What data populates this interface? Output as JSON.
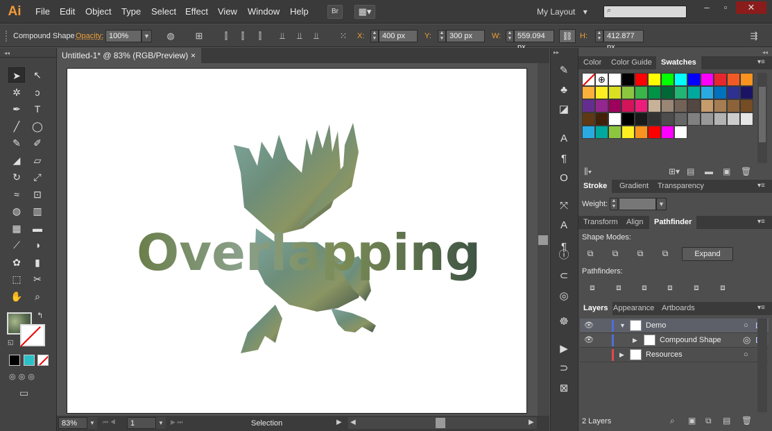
{
  "app": {
    "logo": "Ai"
  },
  "menu": [
    "File",
    "Edit",
    "Object",
    "Type",
    "Select",
    "Effect",
    "View",
    "Window",
    "Help"
  ],
  "topbar": {
    "bridge": "Br",
    "workspace": "My Layout",
    "workspace_arrow": "▾"
  },
  "control": {
    "selection_type": "Compound Shape",
    "opacity_label": "Opacity:",
    "opacity_value": "100%",
    "x_label": "X:",
    "x_value": "400 px",
    "y_label": "Y:",
    "y_value": "300 px",
    "w_label": "W:",
    "w_value": "559.094 px",
    "h_label": "H:",
    "h_value": "412.877 px"
  },
  "document": {
    "tab_title": "Untitled-1* @ 83% (RGB/Preview)",
    "close": "×",
    "artwork_text": "Overlapping"
  },
  "status": {
    "zoom": "83%",
    "artboard": "1",
    "mode": "Selection"
  },
  "swatches_panel": {
    "tabs": [
      "Color",
      "Color Guide",
      "Swatches"
    ],
    "swatch_colors": [
      "#ffffff",
      "#000000",
      "#ff0000",
      "#ffff00",
      "#00ff00",
      "#00ffff",
      "#0000ff",
      "#ff00ff",
      "#e8262e",
      "#f15a24",
      "#f7931e",
      "#fbb03b",
      "#fcee21",
      "#d9e021",
      "#8cc63f",
      "#39b54a",
      "#009245",
      "#006837",
      "#22b573",
      "#00a99d",
      "#29abe2",
      "#0071bc",
      "#2e3192",
      "#1b1464",
      "#662d91",
      "#93278f",
      "#9e005d",
      "#d4145a",
      "#ed1e79",
      "#c7b299",
      "#998675",
      "#736357",
      "#534741",
      "#c69c6d",
      "#a67c52",
      "#8c6239",
      "#754c24",
      "#603813",
      "#42210b",
      "#ffffff",
      "#000000",
      "#1a1a1a",
      "#333333",
      "#4d4d4d",
      "#666666",
      "#808080",
      "#999999",
      "#b3b3b3",
      "#cccccc",
      "#e6e6e6",
      "#29abe2",
      "#00a99d",
      "#8cc63f",
      "#fcee21",
      "#f7931e",
      "#ff0000",
      "#ff00ff",
      "#ffffff"
    ]
  },
  "stroke_panel": {
    "tabs": [
      "Stroke",
      "Gradient",
      "Transparency"
    ],
    "weight_label": "Weight:"
  },
  "pathfinder_panel": {
    "tabs": [
      "Transform",
      "Align",
      "Pathfinder"
    ],
    "shape_modes_label": "Shape Modes:",
    "expand_label": "Expand",
    "pathfinders_label": "Pathfinders:"
  },
  "layers_panel": {
    "tabs": [
      "Layers",
      "Appearance",
      "Artboards"
    ],
    "rows": [
      {
        "name": "Demo",
        "color": "#4f6fd8"
      },
      {
        "name": "Compound Shape",
        "color": "#4f6fd8"
      },
      {
        "name": "Resources",
        "color": "#e24a4a"
      }
    ],
    "count_label": "2 Layers"
  },
  "icons": [
    "selection-tool-icon",
    "direct-selection-tool-icon",
    "magic-wand-icon",
    "lasso-icon",
    "pen-icon",
    "type-icon",
    "line-icon",
    "ellipse-icon",
    "paintbrush-icon",
    "pencil-icon",
    "blob-brush-icon",
    "eraser-icon",
    "rotate-icon",
    "scale-icon",
    "width-icon",
    "free-transform-icon",
    "shape-builder-icon",
    "perspective-grid-icon",
    "mesh-icon",
    "gradient-icon",
    "eyedropper-icon",
    "blend-icon",
    "symbol-sprayer-icon",
    "column-graph-icon",
    "artboard-icon",
    "slice-icon",
    "hand-icon",
    "zoom-icon"
  ]
}
